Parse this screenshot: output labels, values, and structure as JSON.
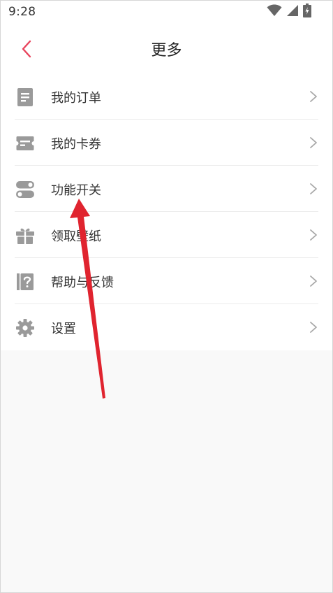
{
  "status_bar": {
    "time": "9:28",
    "icons": [
      "wifi-icon",
      "signal-icon",
      "battery-charging-icon"
    ]
  },
  "header": {
    "title": "更多",
    "back_icon": "chevron-left-icon"
  },
  "menu": {
    "items": [
      {
        "label": "我的订单",
        "icon": "order-list-icon"
      },
      {
        "label": "我的卡券",
        "icon": "coupon-icon"
      },
      {
        "label": "功能开关",
        "icon": "toggle-switch-icon"
      },
      {
        "label": "领取壁纸",
        "icon": "gift-icon"
      },
      {
        "label": "帮助与反馈",
        "icon": "help-icon"
      },
      {
        "label": "设置",
        "icon": "gear-icon"
      }
    ]
  },
  "colors": {
    "accent": "#e8435c",
    "icon_gray": "#9a9a9a",
    "text": "#333333",
    "background": "#f9f9f9",
    "annotation_arrow": "#e0242f"
  }
}
